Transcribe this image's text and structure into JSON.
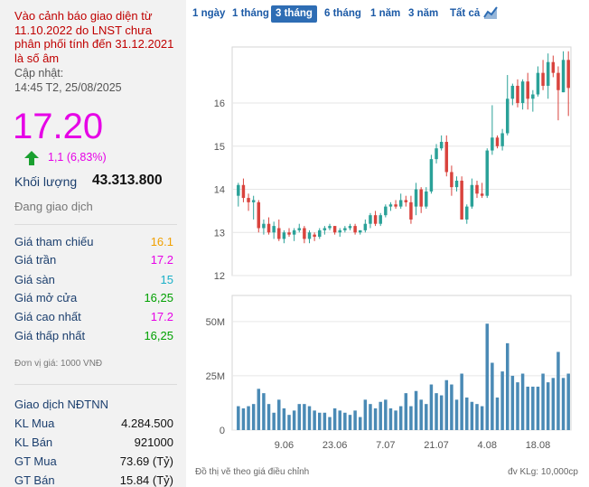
{
  "warning": "Vào cảnh báo giao diện từ 11.10.2022 do LNST chưa phân phối tính đến 31.12.2021 là số âm",
  "updated_label": "Cập nhật:",
  "updated_time": "14:45 T2, 25/08/2025",
  "price": "17.20",
  "change": "1,1 (6,83%)",
  "volume_label": "Khối lượng",
  "volume_value": "43.313.800",
  "trading_status": "Đang giao dịch",
  "stats": [
    {
      "label": "Giá tham chiếu",
      "value": "16.1",
      "color": "#f0a000"
    },
    {
      "label": "Giá trần",
      "value": "17.2",
      "color": "#e600e6"
    },
    {
      "label": "Giá sàn",
      "value": "15",
      "color": "#1ab0c8"
    },
    {
      "label": "Giá mở cửa",
      "value": "16,25",
      "color": "#00a000"
    },
    {
      "label": "Giá cao nhất",
      "value": "17.2",
      "color": "#e600e6"
    },
    {
      "label": "Giá thấp nhất",
      "value": "16,25",
      "color": "#00a000"
    }
  ],
  "price_unit": "Đơn vị giá: 1000 VNĐ",
  "foreign": {
    "title": "Giao dịch NĐTNN",
    "rows": [
      {
        "label": "KL Mua",
        "value": "4.284.500"
      },
      {
        "label": "KL Bán",
        "value": "921000"
      },
      {
        "label": "GT Mua",
        "value": "73.69 (Tỷ)"
      },
      {
        "label": "GT Bán",
        "value": "15.84 (Tỷ)"
      }
    ]
  },
  "tabs": [
    "1 ngày",
    "1 tháng",
    "3 tháng",
    "6 tháng",
    "1 năm",
    "3 năm",
    "Tất cả"
  ],
  "active_tab": "3 tháng",
  "footer_left": "Đồ thị vẽ theo giá điều chỉnh",
  "footer_right": "đv KLg: 10,000cp",
  "colors": {
    "up": "#2aa198",
    "down": "#d9433d",
    "volume": "#4a8ab5",
    "price": "#e600e6",
    "accent": "#2e6db4"
  },
  "chart_data": {
    "type": "candlestick",
    "price_axis": {
      "ticks": [
        12,
        13,
        14,
        15,
        16
      ],
      "ylim": [
        12,
        17.3
      ]
    },
    "volume_axis": {
      "ticks": [
        "0",
        "25M",
        "50M"
      ],
      "tick_values": [
        0,
        25,
        50
      ],
      "unit": "M",
      "ylim": [
        0,
        62
      ]
    },
    "x_tick_labels": [
      {
        "label": "9.06",
        "index": 9
      },
      {
        "label": "23.06",
        "index": 19
      },
      {
        "label": "7.07",
        "index": 29
      },
      {
        "label": "21.07",
        "index": 39
      },
      {
        "label": "4.08",
        "index": 49
      },
      {
        "label": "18.08",
        "index": 59
      }
    ],
    "candles": [
      {
        "o": 13.85,
        "h": 14.15,
        "l": 13.6,
        "c": 14.1,
        "v": 11
      },
      {
        "o": 14.1,
        "h": 14.25,
        "l": 13.7,
        "c": 13.8,
        "v": 10
      },
      {
        "o": 13.8,
        "h": 13.9,
        "l": 13.5,
        "c": 13.7,
        "v": 11
      },
      {
        "o": 13.7,
        "h": 13.85,
        "l": 13.3,
        "c": 13.75,
        "v": 12
      },
      {
        "o": 13.7,
        "h": 13.75,
        "l": 13.0,
        "c": 13.1,
        "v": 19
      },
      {
        "o": 13.1,
        "h": 13.3,
        "l": 12.95,
        "c": 13.2,
        "v": 17
      },
      {
        "o": 13.2,
        "h": 13.35,
        "l": 12.95,
        "c": 13.0,
        "v": 12
      },
      {
        "o": 13.0,
        "h": 13.25,
        "l": 12.85,
        "c": 13.15,
        "v": 8
      },
      {
        "o": 13.1,
        "h": 13.3,
        "l": 12.8,
        "c": 12.85,
        "v": 14
      },
      {
        "o": 12.85,
        "h": 13.05,
        "l": 12.75,
        "c": 13.0,
        "v": 10
      },
      {
        "o": 13.0,
        "h": 13.1,
        "l": 12.9,
        "c": 12.95,
        "v": 7
      },
      {
        "o": 12.95,
        "h": 13.1,
        "l": 12.8,
        "c": 13.05,
        "v": 9
      },
      {
        "o": 13.05,
        "h": 13.2,
        "l": 13.0,
        "c": 13.1,
        "v": 12
      },
      {
        "o": 13.1,
        "h": 13.15,
        "l": 12.75,
        "c": 12.85,
        "v": 12
      },
      {
        "o": 12.85,
        "h": 13.05,
        "l": 12.75,
        "c": 13.0,
        "v": 11
      },
      {
        "o": 12.95,
        "h": 13.0,
        "l": 12.8,
        "c": 12.9,
        "v": 9
      },
      {
        "o": 12.9,
        "h": 13.1,
        "l": 12.85,
        "c": 13.05,
        "v": 8
      },
      {
        "o": 13.05,
        "h": 13.15,
        "l": 12.95,
        "c": 13.1,
        "v": 8
      },
      {
        "o": 13.1,
        "h": 13.2,
        "l": 13.05,
        "c": 13.15,
        "v": 6
      },
      {
        "o": 13.15,
        "h": 13.15,
        "l": 12.95,
        "c": 13.0,
        "v": 10
      },
      {
        "o": 13.0,
        "h": 13.1,
        "l": 12.9,
        "c": 13.05,
        "v": 9
      },
      {
        "o": 13.05,
        "h": 13.15,
        "l": 13.0,
        "c": 13.1,
        "v": 8
      },
      {
        "o": 13.1,
        "h": 13.2,
        "l": 13.05,
        "c": 13.15,
        "v": 7
      },
      {
        "o": 13.15,
        "h": 13.2,
        "l": 12.95,
        "c": 13.0,
        "v": 9
      },
      {
        "o": 13.0,
        "h": 13.05,
        "l": 12.95,
        "c": 13.05,
        "v": 6
      },
      {
        "o": 13.05,
        "h": 13.3,
        "l": 13.0,
        "c": 13.2,
        "v": 14
      },
      {
        "o": 13.2,
        "h": 13.45,
        "l": 13.1,
        "c": 13.4,
        "v": 12
      },
      {
        "o": 13.4,
        "h": 13.5,
        "l": 13.15,
        "c": 13.2,
        "v": 10
      },
      {
        "o": 13.2,
        "h": 13.45,
        "l": 13.15,
        "c": 13.4,
        "v": 13
      },
      {
        "o": 13.4,
        "h": 13.65,
        "l": 13.35,
        "c": 13.6,
        "v": 14
      },
      {
        "o": 13.6,
        "h": 13.7,
        "l": 13.5,
        "c": 13.65,
        "v": 10
      },
      {
        "o": 13.65,
        "h": 13.75,
        "l": 13.55,
        "c": 13.6,
        "v": 9
      },
      {
        "o": 13.6,
        "h": 13.9,
        "l": 13.55,
        "c": 13.75,
        "v": 11
      },
      {
        "o": 13.75,
        "h": 13.85,
        "l": 13.6,
        "c": 13.7,
        "v": 17
      },
      {
        "o": 13.7,
        "h": 13.85,
        "l": 13.2,
        "c": 13.3,
        "v": 11
      },
      {
        "o": 13.6,
        "h": 14.15,
        "l": 13.4,
        "c": 14.0,
        "v": 18
      },
      {
        "o": 14.0,
        "h": 14.05,
        "l": 13.45,
        "c": 13.6,
        "v": 14
      },
      {
        "o": 13.6,
        "h": 14.05,
        "l": 13.55,
        "c": 13.95,
        "v": 12
      },
      {
        "o": 13.95,
        "h": 14.8,
        "l": 13.9,
        "c": 14.7,
        "v": 21
      },
      {
        "o": 14.7,
        "h": 15.05,
        "l": 14.6,
        "c": 14.95,
        "v": 17
      },
      {
        "o": 14.95,
        "h": 15.25,
        "l": 14.9,
        "c": 15.1,
        "v": 16
      },
      {
        "o": 15.1,
        "h": 15.25,
        "l": 14.3,
        "c": 14.4,
        "v": 23
      },
      {
        "o": 14.4,
        "h": 14.55,
        "l": 13.85,
        "c": 14.05,
        "v": 21
      },
      {
        "o": 14.05,
        "h": 14.3,
        "l": 13.95,
        "c": 14.2,
        "v": 14
      },
      {
        "o": 14.2,
        "h": 14.3,
        "l": 13.3,
        "c": 13.3,
        "v": 26
      },
      {
        "o": 13.3,
        "h": 13.65,
        "l": 13.2,
        "c": 13.6,
        "v": 15
      },
      {
        "o": 13.6,
        "h": 14.25,
        "l": 13.55,
        "c": 14.1,
        "v": 13
      },
      {
        "o": 14.1,
        "h": 14.2,
        "l": 13.8,
        "c": 13.9,
        "v": 12
      },
      {
        "o": 13.9,
        "h": 14.15,
        "l": 13.8,
        "c": 13.85,
        "v": 11
      },
      {
        "o": 13.85,
        "h": 14.95,
        "l": 13.8,
        "c": 14.9,
        "v": 49
      },
      {
        "o": 14.9,
        "h": 15.95,
        "l": 14.8,
        "c": 15.2,
        "v": 31
      },
      {
        "o": 15.2,
        "h": 15.25,
        "l": 14.95,
        "c": 15.0,
        "v": 15
      },
      {
        "o": 15.0,
        "h": 15.4,
        "l": 14.9,
        "c": 15.3,
        "v": 27
      },
      {
        "o": 15.3,
        "h": 16.65,
        "l": 15.25,
        "c": 16.1,
        "v": 40
      },
      {
        "o": 16.1,
        "h": 16.45,
        "l": 15.95,
        "c": 16.4,
        "v": 25
      },
      {
        "o": 16.4,
        "h": 16.55,
        "l": 15.9,
        "c": 16.0,
        "v": 22
      },
      {
        "o": 16.0,
        "h": 16.55,
        "l": 15.85,
        "c": 16.5,
        "v": 26
      },
      {
        "o": 16.5,
        "h": 16.7,
        "l": 15.85,
        "c": 16.1,
        "v": 20
      },
      {
        "o": 16.1,
        "h": 16.3,
        "l": 15.8,
        "c": 16.2,
        "v": 20
      },
      {
        "o": 16.2,
        "h": 16.85,
        "l": 16.15,
        "c": 16.7,
        "v": 20
      },
      {
        "o": 16.7,
        "h": 17.0,
        "l": 16.3,
        "c": 16.4,
        "v": 26
      },
      {
        "o": 16.4,
        "h": 17.15,
        "l": 16.1,
        "c": 16.95,
        "v": 22
      },
      {
        "o": 16.95,
        "h": 17.1,
        "l": 16.6,
        "c": 16.7,
        "v": 24
      },
      {
        "o": 16.7,
        "h": 16.85,
        "l": 15.6,
        "c": 16.3,
        "v": 36
      },
      {
        "o": 16.25,
        "h": 17.2,
        "l": 16.25,
        "c": 17.0,
        "v": 24
      },
      {
        "o": 17.0,
        "h": 17.2,
        "l": 15.7,
        "c": 16.35,
        "v": 26
      }
    ]
  }
}
